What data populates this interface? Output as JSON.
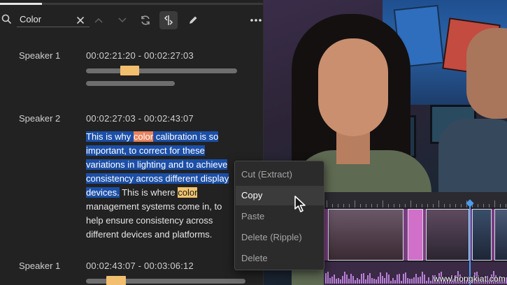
{
  "toolbar": {
    "search_value": "Color",
    "progress_fraction": 0.16,
    "icons": [
      "search-icon",
      "close-icon",
      "chevron-up-icon",
      "chevron-down-icon",
      "refresh-icon",
      "split-clip-icon",
      "pencil-icon",
      "more-icon"
    ]
  },
  "transcript": {
    "blocks": [
      {
        "speaker": "Speaker 1",
        "timecode": "00:02:21:20 - 00:02:27:03"
      },
      {
        "speaker": "Speaker 2",
        "timecode": "00:02:27:03 - 00:02:43:07",
        "text": {
          "s1": "This is why ",
          "s1_hl": "color",
          "s1_rest": " calibration is so",
          "s2": "important, to correct for these",
          "s3": "variations in lighting and to achieve",
          "s4": "consistency across different display",
          "s5": "devices.",
          "u1": " This is where ",
          "u1_hl": "color",
          "u2": "management systems come in, to",
          "u3": "help ensure consistency across",
          "u4": "different devices and platforms."
        }
      },
      {
        "speaker": "Speaker 1",
        "timecode": "00:02:43:07 - 00:03:06:12"
      }
    ]
  },
  "context_menu": {
    "items": [
      {
        "label": "Cut (Extract)",
        "active": false
      },
      {
        "label": "Copy",
        "active": true
      },
      {
        "label": "Paste",
        "active": false
      },
      {
        "label": "Delete (Ripple)",
        "active": false
      },
      {
        "label": "Delete",
        "active": false
      }
    ]
  },
  "colors": {
    "selection": "#1b4fa8",
    "search_highlight": "#f2c46f",
    "selected_search_highlight": "#e8825e",
    "playhead": "#4a9ef0",
    "video_track": "#7a3d80"
  },
  "watermark": "www.hongkiat.com"
}
